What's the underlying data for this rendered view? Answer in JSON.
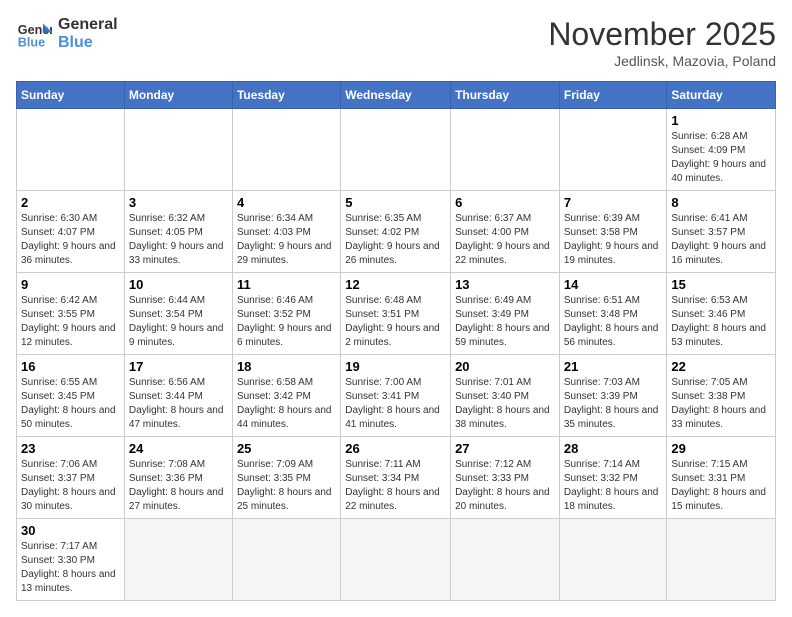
{
  "logo": {
    "line1": "General",
    "line2": "Blue"
  },
  "title": "November 2025",
  "subtitle": "Jedlinsk, Mazovia, Poland",
  "days_of_week": [
    "Sunday",
    "Monday",
    "Tuesday",
    "Wednesday",
    "Thursday",
    "Friday",
    "Saturday"
  ],
  "weeks": [
    [
      {
        "day": "",
        "info": ""
      },
      {
        "day": "",
        "info": ""
      },
      {
        "day": "",
        "info": ""
      },
      {
        "day": "",
        "info": ""
      },
      {
        "day": "",
        "info": ""
      },
      {
        "day": "",
        "info": ""
      },
      {
        "day": "1",
        "info": "Sunrise: 6:28 AM\nSunset: 4:09 PM\nDaylight: 9 hours and 40 minutes."
      }
    ],
    [
      {
        "day": "2",
        "info": "Sunrise: 6:30 AM\nSunset: 4:07 PM\nDaylight: 9 hours and 36 minutes."
      },
      {
        "day": "3",
        "info": "Sunrise: 6:32 AM\nSunset: 4:05 PM\nDaylight: 9 hours and 33 minutes."
      },
      {
        "day": "4",
        "info": "Sunrise: 6:34 AM\nSunset: 4:03 PM\nDaylight: 9 hours and 29 minutes."
      },
      {
        "day": "5",
        "info": "Sunrise: 6:35 AM\nSunset: 4:02 PM\nDaylight: 9 hours and 26 minutes."
      },
      {
        "day": "6",
        "info": "Sunrise: 6:37 AM\nSunset: 4:00 PM\nDaylight: 9 hours and 22 minutes."
      },
      {
        "day": "7",
        "info": "Sunrise: 6:39 AM\nSunset: 3:58 PM\nDaylight: 9 hours and 19 minutes."
      },
      {
        "day": "8",
        "info": "Sunrise: 6:41 AM\nSunset: 3:57 PM\nDaylight: 9 hours and 16 minutes."
      }
    ],
    [
      {
        "day": "9",
        "info": "Sunrise: 6:42 AM\nSunset: 3:55 PM\nDaylight: 9 hours and 12 minutes."
      },
      {
        "day": "10",
        "info": "Sunrise: 6:44 AM\nSunset: 3:54 PM\nDaylight: 9 hours and 9 minutes."
      },
      {
        "day": "11",
        "info": "Sunrise: 6:46 AM\nSunset: 3:52 PM\nDaylight: 9 hours and 6 minutes."
      },
      {
        "day": "12",
        "info": "Sunrise: 6:48 AM\nSunset: 3:51 PM\nDaylight: 9 hours and 2 minutes."
      },
      {
        "day": "13",
        "info": "Sunrise: 6:49 AM\nSunset: 3:49 PM\nDaylight: 8 hours and 59 minutes."
      },
      {
        "day": "14",
        "info": "Sunrise: 6:51 AM\nSunset: 3:48 PM\nDaylight: 8 hours and 56 minutes."
      },
      {
        "day": "15",
        "info": "Sunrise: 6:53 AM\nSunset: 3:46 PM\nDaylight: 8 hours and 53 minutes."
      }
    ],
    [
      {
        "day": "16",
        "info": "Sunrise: 6:55 AM\nSunset: 3:45 PM\nDaylight: 8 hours and 50 minutes."
      },
      {
        "day": "17",
        "info": "Sunrise: 6:56 AM\nSunset: 3:44 PM\nDaylight: 8 hours and 47 minutes."
      },
      {
        "day": "18",
        "info": "Sunrise: 6:58 AM\nSunset: 3:42 PM\nDaylight: 8 hours and 44 minutes."
      },
      {
        "day": "19",
        "info": "Sunrise: 7:00 AM\nSunset: 3:41 PM\nDaylight: 8 hours and 41 minutes."
      },
      {
        "day": "20",
        "info": "Sunrise: 7:01 AM\nSunset: 3:40 PM\nDaylight: 8 hours and 38 minutes."
      },
      {
        "day": "21",
        "info": "Sunrise: 7:03 AM\nSunset: 3:39 PM\nDaylight: 8 hours and 35 minutes."
      },
      {
        "day": "22",
        "info": "Sunrise: 7:05 AM\nSunset: 3:38 PM\nDaylight: 8 hours and 33 minutes."
      }
    ],
    [
      {
        "day": "23",
        "info": "Sunrise: 7:06 AM\nSunset: 3:37 PM\nDaylight: 8 hours and 30 minutes."
      },
      {
        "day": "24",
        "info": "Sunrise: 7:08 AM\nSunset: 3:36 PM\nDaylight: 8 hours and 27 minutes."
      },
      {
        "day": "25",
        "info": "Sunrise: 7:09 AM\nSunset: 3:35 PM\nDaylight: 8 hours and 25 minutes."
      },
      {
        "day": "26",
        "info": "Sunrise: 7:11 AM\nSunset: 3:34 PM\nDaylight: 8 hours and 22 minutes."
      },
      {
        "day": "27",
        "info": "Sunrise: 7:12 AM\nSunset: 3:33 PM\nDaylight: 8 hours and 20 minutes."
      },
      {
        "day": "28",
        "info": "Sunrise: 7:14 AM\nSunset: 3:32 PM\nDaylight: 8 hours and 18 minutes."
      },
      {
        "day": "29",
        "info": "Sunrise: 7:15 AM\nSunset: 3:31 PM\nDaylight: 8 hours and 15 minutes."
      }
    ],
    [
      {
        "day": "30",
        "info": "Sunrise: 7:17 AM\nSunset: 3:30 PM\nDaylight: 8 hours and 13 minutes."
      },
      {
        "day": "",
        "info": ""
      },
      {
        "day": "",
        "info": ""
      },
      {
        "day": "",
        "info": ""
      },
      {
        "day": "",
        "info": ""
      },
      {
        "day": "",
        "info": ""
      },
      {
        "day": "",
        "info": ""
      }
    ]
  ]
}
